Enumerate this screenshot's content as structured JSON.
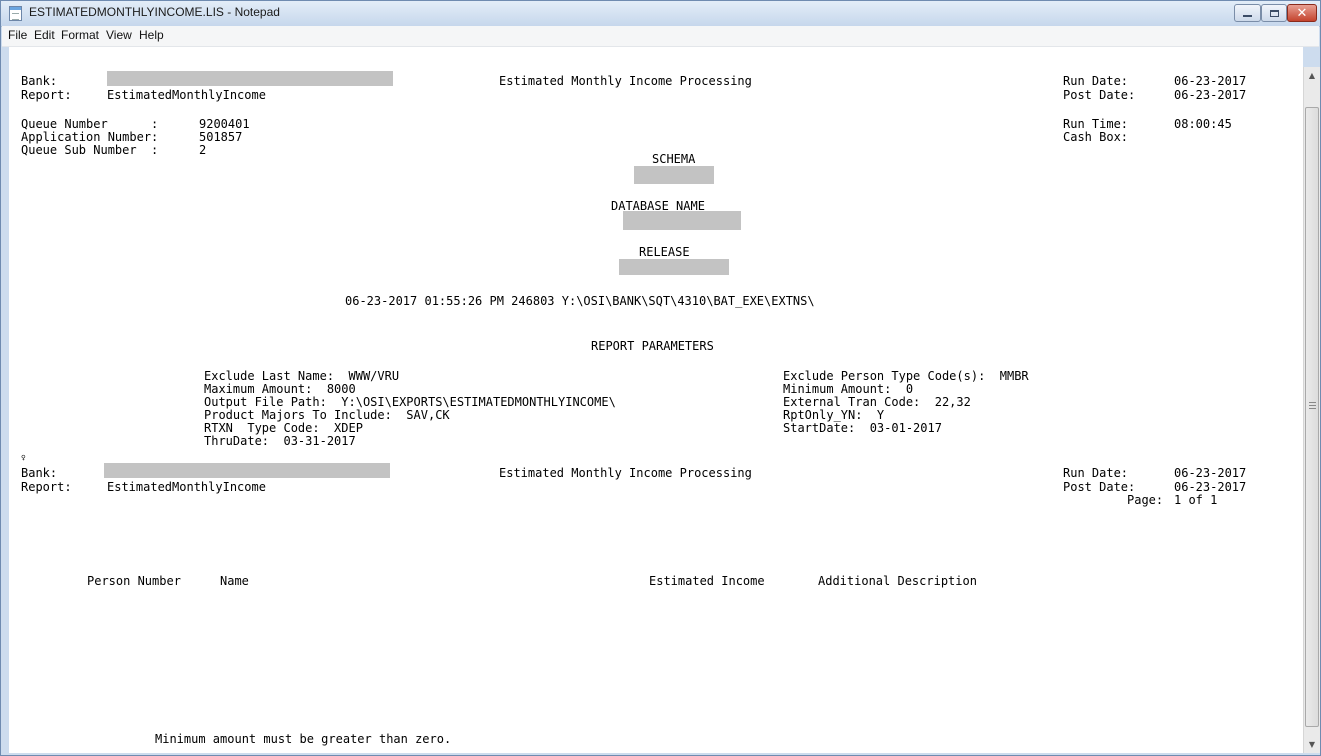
{
  "window": {
    "title": "ESTIMATEDMONTHLYINCOME.LIS - Notepad",
    "icon": "notepad-icon"
  },
  "menu": [
    "File",
    "Edit",
    "Format",
    "View",
    "Help"
  ],
  "report": {
    "header1": {
      "bank_label": "Bank:",
      "report_label": "Report:",
      "report_name": "EstimatedMonthlyIncome",
      "title": "Estimated Monthly Income Processing",
      "run_date_label": "Run Date:",
      "run_date": "06-23-2017",
      "post_date_label": "Post Date:",
      "post_date": "06-23-2017"
    },
    "queue_number_label": "Queue Number      :",
    "queue_number": "9200401",
    "application_number_label": "Application Number:",
    "application_number": "501857",
    "queue_sub_number_label": "Queue Sub Number  :",
    "queue_sub_number": "2",
    "run_time_label": "Run Time:",
    "run_time": "08:00:45",
    "cash_box_label": "Cash Box:",
    "schema_label": "SCHEMA",
    "database_label": "DATABASE NAME",
    "release_label": "RELEASE",
    "exe_line": "06-23-2017 01:55:26 PM 246803 Y:\\OSI\\BANK\\SQT\\4310\\BAT_EXE\\EXTNS\\",
    "params_heading": "REPORT PARAMETERS",
    "params_left": [
      "Exclude Last Name:  WWW/VRU",
      "Maximum Amount:  8000",
      "Output File Path:  Y:\\OSI\\EXPORTS\\ESTIMATEDMONTHLYINCOME\\",
      "Product Majors To Include:  SAV,CK",
      "RTXN  Type Code:  XDEP",
      "ThruDate:  03-31-2017"
    ],
    "params_right": [
      "Exclude Person Type Code(s):  MMBR",
      "Minimum Amount:  0",
      "External Tran Code:  22,32",
      "RptOnly_YN:  Y",
      "StartDate:  03-01-2017"
    ],
    "form_feed": "♀",
    "header2": {
      "bank_label": "Bank:",
      "report_label": "Report:",
      "report_name": "EstimatedMonthlyIncome",
      "title": "Estimated Monthly Income Processing",
      "run_date_label": "Run Date:",
      "run_date": "06-23-2017",
      "post_date_label": "Post Date:",
      "post_date": "06-23-2017",
      "page_label": "Page:",
      "page": "1 of 1"
    },
    "columns": [
      "Person Number",
      "Name",
      "Estimated Income",
      "Additional Description"
    ],
    "message": "Minimum amount must be greater than zero."
  }
}
